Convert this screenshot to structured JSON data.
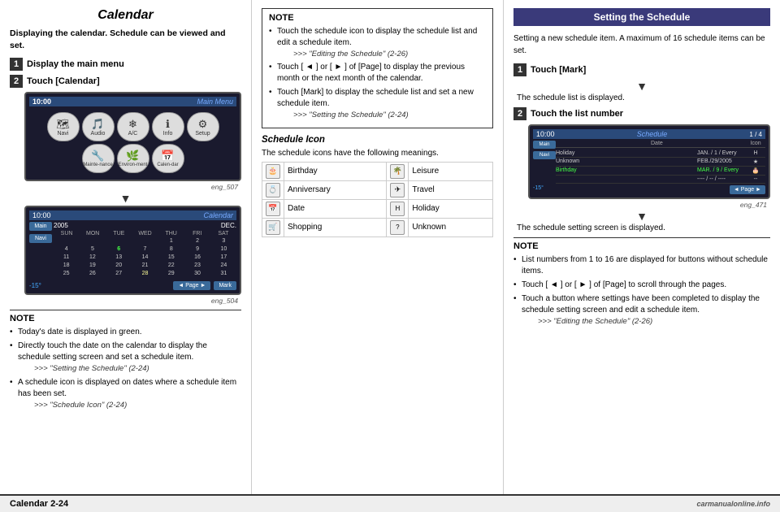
{
  "header": {
    "page_title": "Calendar"
  },
  "left": {
    "intro": "Displaying the calendar. Schedule can be viewed and set.",
    "step1_label": "Display the main menu",
    "step2_label": "Touch [Calendar]",
    "screen1": {
      "time": "10:00",
      "title": "Main Menu",
      "caption": "eng_507",
      "icons": [
        {
          "label": "Navi",
          "ico": "🗺"
        },
        {
          "label": "Audio",
          "ico": "🎵"
        },
        {
          "label": "A/C",
          "ico": "❄"
        },
        {
          "label": "Info",
          "ico": "ℹ"
        },
        {
          "label": "Setup",
          "ico": "⚙"
        },
        {
          "label": "Mainte-\nnance",
          "ico": "🔧"
        },
        {
          "label": "Environ-\nment",
          "ico": "🌿"
        },
        {
          "label": "Calen-\ndar",
          "ico": "📅"
        }
      ]
    },
    "screen2": {
      "time": "10:00",
      "title": "Calendar",
      "year": "2005",
      "month": "DEC.",
      "caption": "eng_504",
      "days_header": [
        "SUN",
        "MON",
        "TUE",
        "WED",
        "THU",
        "FRI",
        "SAT"
      ],
      "days": [
        "",
        "",
        "",
        "",
        "1",
        "2",
        "3",
        "4",
        "5",
        "6",
        "7",
        "8",
        "9",
        "10",
        "11",
        "12",
        "13",
        "14",
        "15",
        "16",
        "17",
        "18",
        "19",
        "20",
        "21",
        "22",
        "23",
        "24",
        "25",
        "26",
        "27",
        "28",
        "29",
        "30",
        "31"
      ],
      "today_index": 8,
      "has_item_indices": [
        21,
        28
      ],
      "temp": "-15°",
      "side_btns": [
        "Main",
        "Navi"
      ],
      "bottom_btns": [
        "◄ Page ►",
        "Mark"
      ]
    },
    "note": {
      "title": "NOTE",
      "items": [
        {
          "text": "Today's date is displayed in green."
        },
        {
          "text": "Directly touch the date on the calendar to display the schedule setting screen and set a schedule item.",
          "ref": "\"Setting the Schedule\" (2-24)"
        },
        {
          "text": "A schedule icon is displayed on dates where a schedule item has been set.",
          "ref": "\"Schedule Icon\" (2-24)"
        }
      ]
    }
  },
  "mid": {
    "note_top": {
      "title": "NOTE",
      "items": [
        {
          "text": "Touch the schedule icon to display the schedule list and edit a schedule item.",
          "ref": "\"Editing the Schedule\" (2-26)"
        },
        {
          "text": "Touch [ ◄ ] or [ ► ] of [Page] to display the previous month or the next month of the calendar."
        },
        {
          "text": "Touch [Mark] to display the schedule list and set a new schedule item.",
          "ref": "\"Setting the Schedule\" (2-24)"
        }
      ]
    },
    "section_title": "Schedule Icon",
    "section_desc": "The schedule icons have the following meanings.",
    "icon_table": [
      {
        "icon_l": "🎂",
        "label_l": "Birthday",
        "icon_r": "🌴",
        "label_r": "Leisure"
      },
      {
        "icon_l": "💍",
        "label_l": "Anniversary",
        "icon_r": "✈",
        "label_r": "Travel"
      },
      {
        "icon_l": "📅",
        "label_l": "Date",
        "icon_r": "H",
        "label_r": "Holiday"
      },
      {
        "icon_l": "🛒",
        "label_l": "Shopping",
        "icon_r": "?",
        "label_r": "Unknown"
      }
    ]
  },
  "right": {
    "header": "Setting the Schedule",
    "intro": "Setting a new schedule item. A maximum of 16 schedule items can be set.",
    "step1_label": "Touch [Mark]",
    "step1_note": "The schedule list is displayed.",
    "step2_label": "Touch the list number",
    "screen": {
      "time": "10:00",
      "title": "Schedule",
      "count": "1 / 4",
      "caption": "eng_471",
      "side_btns": [
        "Main",
        "Navi"
      ],
      "col_headers": [
        "",
        "Date",
        "Icon"
      ],
      "rows": [
        {
          "label": "Holiday",
          "value": "JAN. / 1 / Every",
          "icon": "H",
          "highlight": false
        },
        {
          "label": "Unknown",
          "value": "FEB. / 29 / 2005",
          "icon": "★",
          "highlight": false
        },
        {
          "label": "Birthday",
          "value": "MAR. / 9 / Every",
          "icon": "🎂",
          "highlight": true
        },
        {
          "label": "",
          "value": "---- / -- / ----",
          "icon": "--",
          "highlight": false
        }
      ],
      "temp": "-15°",
      "page_btn": "◄ Page ►"
    },
    "screen_note": "The schedule setting screen is displayed.",
    "note": {
      "title": "NOTE",
      "items": [
        {
          "text": "List numbers from 1 to 16 are displayed for buttons without schedule items."
        },
        {
          "text": "Touch [ ◄ ] or [ ► ] of [Page] to scroll through the pages."
        },
        {
          "text": "Touch a button where settings have been completed to display the schedule setting screen and edit a schedule item.",
          "ref": "\"Editing the Schedule\" (2-26)"
        }
      ]
    }
  },
  "footer": {
    "label": "Calendar  2-24",
    "watermark": "carmanualonline.info"
  }
}
